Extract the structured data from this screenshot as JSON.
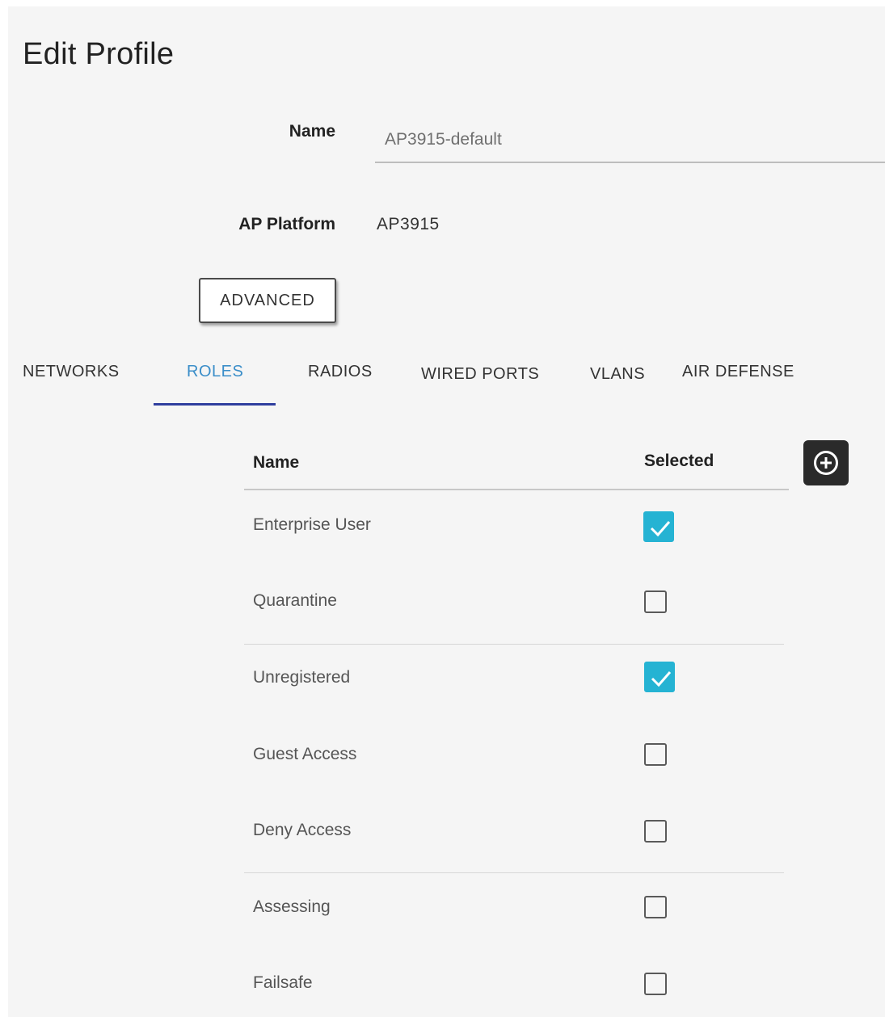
{
  "page": {
    "title": "Edit Profile"
  },
  "form": {
    "name_label": "Name",
    "name_value": "AP3915-default",
    "platform_label": "AP Platform",
    "platform_value": "AP3915",
    "advanced_label": "ADVANCED"
  },
  "tabs": [
    {
      "label": "NETWORKS",
      "active": false
    },
    {
      "label": "ROLES",
      "active": true
    },
    {
      "label": "RADIOS",
      "active": false
    },
    {
      "label": "WIRED PORTS",
      "active": false
    },
    {
      "label": "VLANS",
      "active": false
    },
    {
      "label": "AIR DEFENSE",
      "active": false
    }
  ],
  "table": {
    "headers": {
      "name": "Name",
      "selected": "Selected"
    },
    "add_icon": "plus-circle-icon",
    "rows": [
      {
        "name": "Enterprise User",
        "selected": true
      },
      {
        "name": "Quarantine",
        "selected": false
      },
      {
        "name": "Unregistered",
        "selected": true
      },
      {
        "name": "Guest Access",
        "selected": false
      },
      {
        "name": "Deny Access",
        "selected": false
      },
      {
        "name": "Assessing",
        "selected": false
      },
      {
        "name": "Failsafe",
        "selected": false
      }
    ]
  },
  "colors": {
    "accent": "#25b3d3",
    "tab_active": "#3b8ec9",
    "tab_underline": "#2f3e9e"
  }
}
